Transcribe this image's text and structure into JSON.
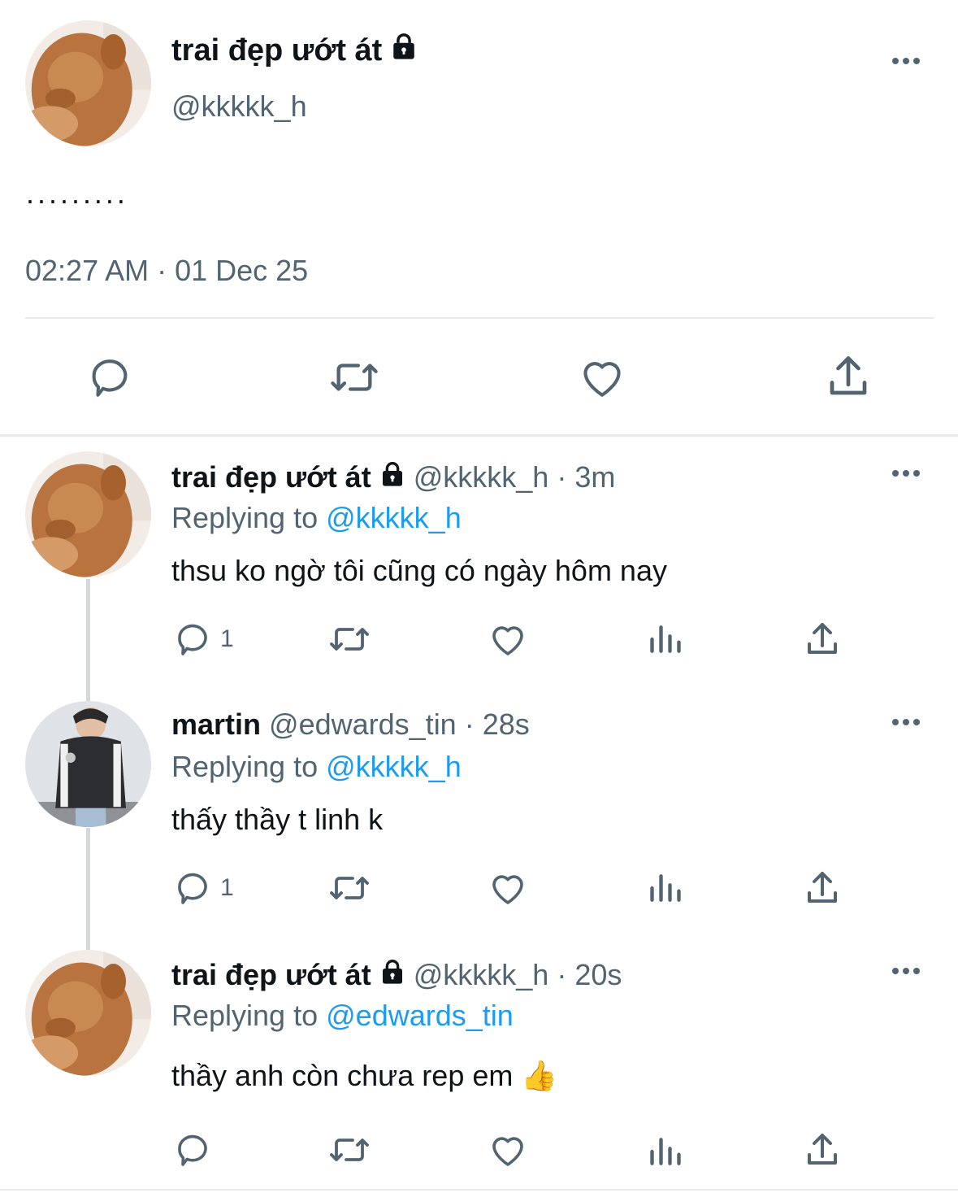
{
  "main_tweet": {
    "display_name": "trai đẹp ướt át",
    "handle": "@kkkkk_h",
    "text": "·········",
    "timestamp": "02:27 AM · 01 Dec 25"
  },
  "replies": [
    {
      "display_name": "trai đẹp ướt át",
      "handle": "@kkkkk_h",
      "time": "· 3m",
      "replying_prefix": "Replying to",
      "replying_to": "@kkkkk_h",
      "text": "thsu ko ngờ tôi cũng có ngày hôm nay",
      "reply_count": "1"
    },
    {
      "display_name": "martin",
      "handle": "@edwards_tin",
      "time": "· 28s",
      "replying_prefix": "Replying to",
      "replying_to": "@kkkkk_h",
      "text": "thấy thầy t linh k",
      "reply_count": "1"
    },
    {
      "display_name": "trai đẹp ướt át",
      "handle": "@kkkkk_h",
      "time": "· 20s",
      "replying_prefix": "Replying to",
      "replying_to": "@edwards_tin",
      "text": "thầy anh còn chưa rep em 👍",
      "reply_count": ""
    }
  ],
  "icons": {
    "lock": "lock-icon",
    "more": "more-dots-icon",
    "reply": "speech-bubble-icon",
    "retweet": "retweet-arrows-icon",
    "like": "heart-icon",
    "views": "bar-chart-icon",
    "share": "upload-share-icon"
  },
  "colors": {
    "text": "#0f1419",
    "muted": "#536471",
    "link": "#1d9bf0",
    "divider": "#e6e8eb",
    "thread_line": "#d6d9dc"
  }
}
